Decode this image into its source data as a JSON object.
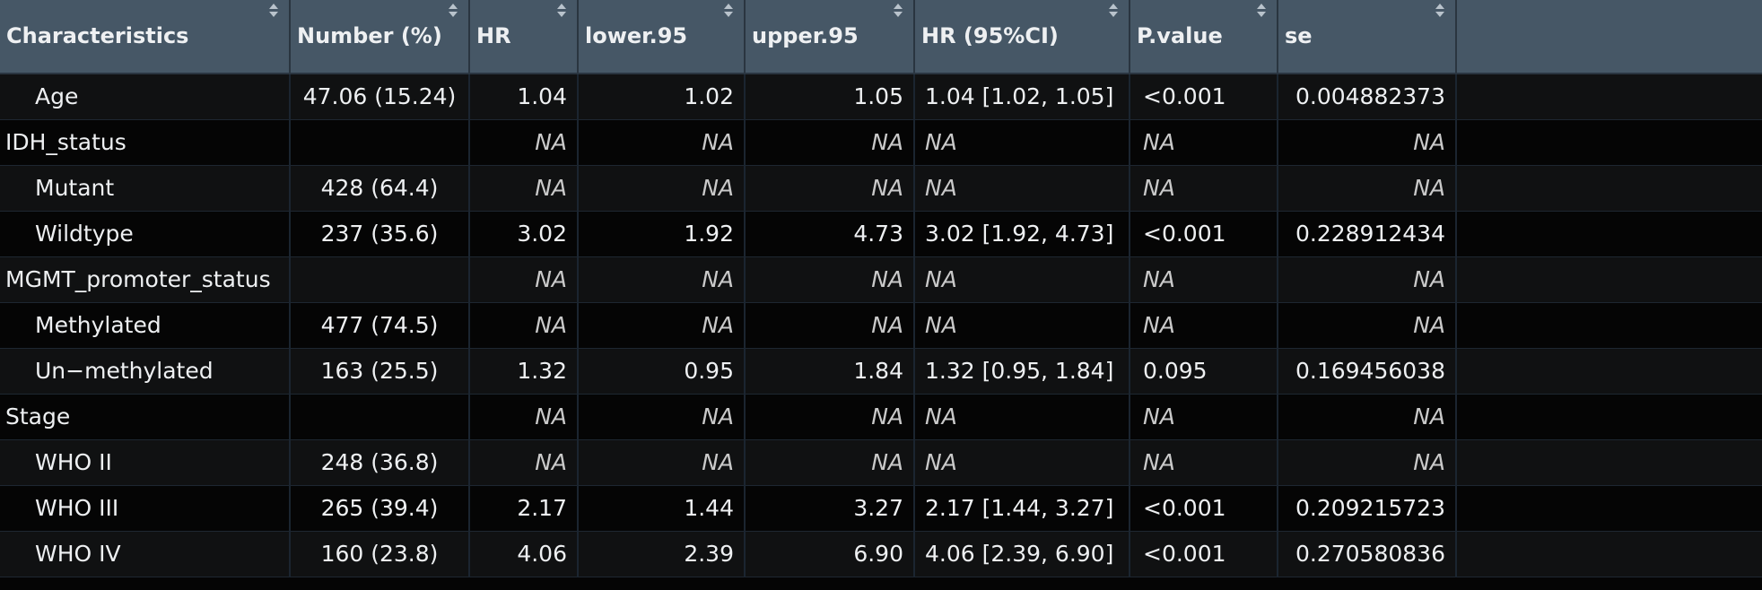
{
  "columns": [
    {
      "key": "characteristics",
      "label": "Characteristics"
    },
    {
      "key": "number",
      "label": "Number (%)"
    },
    {
      "key": "hr",
      "label": "HR"
    },
    {
      "key": "lower95",
      "label": "lower.95"
    },
    {
      "key": "upper95",
      "label": "upper.95"
    },
    {
      "key": "hrci",
      "label": "HR (95%CI)"
    },
    {
      "key": "pvalue",
      "label": "P.value"
    },
    {
      "key": "se",
      "label": "se"
    },
    {
      "key": "blank",
      "label": ""
    }
  ],
  "rows": [
    {
      "characteristics": "Age",
      "sub": true,
      "number": "47.06 (15.24)",
      "hr": "1.04",
      "lower95": "1.02",
      "upper95": "1.05",
      "hrci": "1.04 [1.02, 1.05]",
      "pvalue": "<0.001",
      "se": "0.004882373"
    },
    {
      "characteristics": "IDH_status",
      "sub": false,
      "number": "",
      "hr": "NA",
      "lower95": "NA",
      "upper95": "NA",
      "hrci": "NA",
      "pvalue": "NA",
      "se": "NA"
    },
    {
      "characteristics": "Mutant",
      "sub": true,
      "number": "428 (64.4)",
      "hr": "NA",
      "lower95": "NA",
      "upper95": "NA",
      "hrci": "NA",
      "pvalue": "NA",
      "se": "NA"
    },
    {
      "characteristics": "Wildtype",
      "sub": true,
      "number": "237 (35.6)",
      "hr": "3.02",
      "lower95": "1.92",
      "upper95": "4.73",
      "hrci": "3.02 [1.92, 4.73]",
      "pvalue": "<0.001",
      "se": "0.228912434"
    },
    {
      "characteristics": "MGMT_promoter_status",
      "sub": false,
      "number": "",
      "hr": "NA",
      "lower95": "NA",
      "upper95": "NA",
      "hrci": "NA",
      "pvalue": "NA",
      "se": "NA"
    },
    {
      "characteristics": "Methylated",
      "sub": true,
      "number": "477 (74.5)",
      "hr": "NA",
      "lower95": "NA",
      "upper95": "NA",
      "hrci": "NA",
      "pvalue": "NA",
      "se": "NA"
    },
    {
      "characteristics": "Un−methylated",
      "sub": true,
      "number": "163 (25.5)",
      "hr": "1.32",
      "lower95": "0.95",
      "upper95": "1.84",
      "hrci": "1.32 [0.95, 1.84]",
      "pvalue": "0.095",
      "se": "0.169456038"
    },
    {
      "characteristics": "Stage",
      "sub": false,
      "number": "",
      "hr": "NA",
      "lower95": "NA",
      "upper95": "NA",
      "hrci": "NA",
      "pvalue": "NA",
      "se": "NA"
    },
    {
      "characteristics": "WHO II",
      "sub": true,
      "number": "248 (36.8)",
      "hr": "NA",
      "lower95": "NA",
      "upper95": "NA",
      "hrci": "NA",
      "pvalue": "NA",
      "se": "NA"
    },
    {
      "characteristics": "WHO III",
      "sub": true,
      "number": "265 (39.4)",
      "hr": "2.17",
      "lower95": "1.44",
      "upper95": "3.27",
      "hrci": "2.17 [1.44, 3.27]",
      "pvalue": "<0.001",
      "se": "0.209215723"
    },
    {
      "characteristics": "WHO IV",
      "sub": true,
      "number": "160 (23.8)",
      "hr": "4.06",
      "lower95": "2.39",
      "upper95": "6.90",
      "hrci": "4.06 [2.39, 6.90]",
      "pvalue": "<0.001",
      "se": "0.270580836"
    }
  ]
}
